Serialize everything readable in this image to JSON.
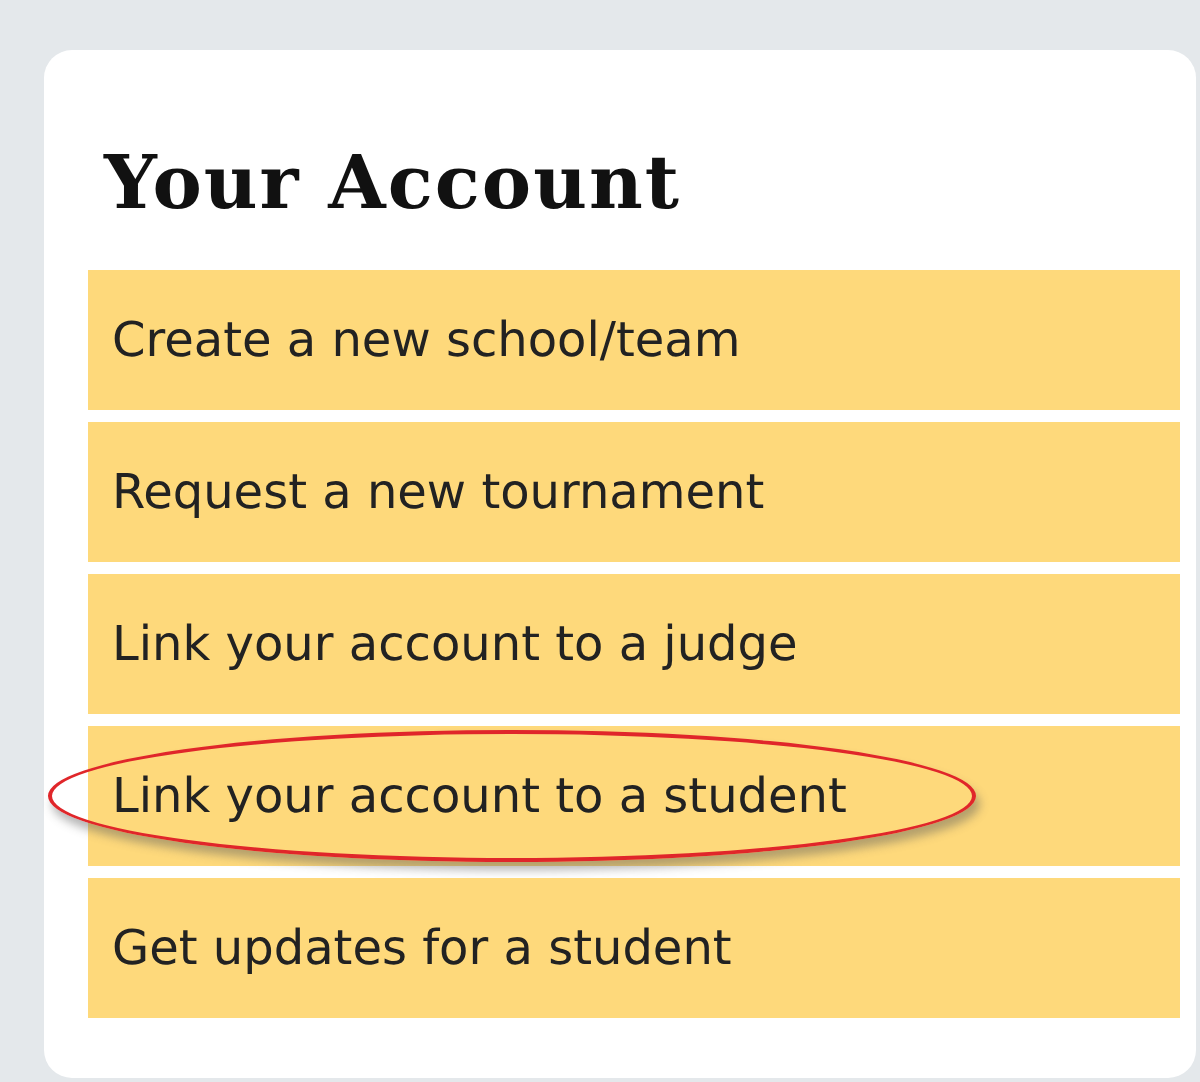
{
  "panel": {
    "title": "Your Account",
    "items": [
      {
        "label": "Create a new school/team",
        "circled": false
      },
      {
        "label": "Request a new tournament",
        "circled": false
      },
      {
        "label": "Link your account to a judge",
        "circled": false
      },
      {
        "label": "Link your account to a student",
        "circled": true
      },
      {
        "label": "Get updates for a student",
        "circled": false
      }
    ]
  }
}
